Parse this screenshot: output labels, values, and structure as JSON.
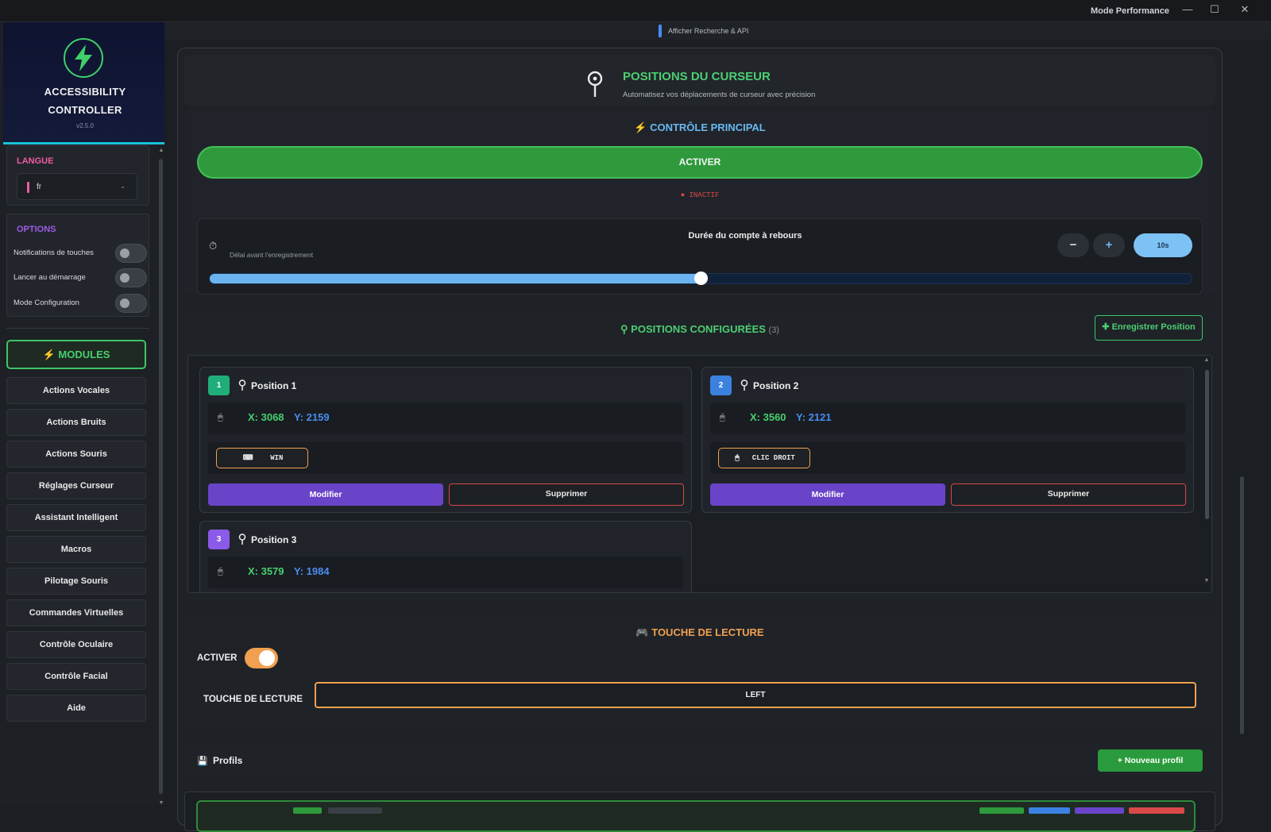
{
  "titlebar": {
    "mode": "Mode Performance",
    "minimize": "—",
    "maximize": "☐",
    "close": "✕"
  },
  "brand": {
    "line1": "ACCESSIBILITY",
    "line2": "CONTROLLER",
    "version": "v2.5.0",
    "icon": "lightning-bolt-icon"
  },
  "langue": {
    "title": "LANGUE",
    "value": "fr",
    "title_color": "#f05aa0"
  },
  "options": {
    "title": "OPTIONS",
    "title_color": "#a05ae8",
    "items": [
      {
        "label": "Notifications de touches",
        "on": false
      },
      {
        "label": "Lancer au démarrage",
        "on": false
      },
      {
        "label": "Mode Configuration",
        "on": false
      }
    ]
  },
  "modules": {
    "label": "MODULES",
    "accent": "#46d06e"
  },
  "nav": [
    "Actions Vocales",
    "Actions Bruits",
    "Actions Souris",
    "Réglages Curseur",
    "Assistant Intelligent",
    "Macros",
    "Pilotage Souris",
    "Commandes Virtuelles",
    "Contrôle Oculaire",
    "Contrôle Facial",
    "Aide"
  ],
  "api_strip": {
    "label": "Afficher Recherche & API"
  },
  "header": {
    "title": "POSITIONS DU CURSEUR",
    "subtitle": "Automatisez vos déplacements de curseur avec précision"
  },
  "control": {
    "title": "CONTRÔLE PRINCIPAL",
    "activate_label": "ACTIVER",
    "status": "INACTIF",
    "countdown": {
      "title": "Durée du compte à rebours",
      "subtitle": "Délai avant l'enregistrement",
      "minus": "−",
      "plus": "+",
      "value_label": "10s",
      "fraction": 0.5
    }
  },
  "positions": {
    "title": "POSITIONS CONFIGURÉES",
    "count": "(3)",
    "register_label": "Enregistrer Position",
    "items": [
      {
        "num": "1",
        "name": "Position 1",
        "x": "X: 3068",
        "y": "Y: 2159",
        "key": "WIN",
        "key_icon": "⌨",
        "color": "#1fae7a"
      },
      {
        "num": "2",
        "name": "Position 2",
        "x": "X: 3560",
        "y": "Y: 2121",
        "key": "CLIC DROIT",
        "key_icon": "🖱",
        "color": "#3b82e0"
      },
      {
        "num": "3",
        "name": "Position 3",
        "x": "X: 3579",
        "y": "Y: 1984",
        "key": "",
        "key_icon": "",
        "color": "#8b5ae8"
      }
    ],
    "edit_label": "Modifier",
    "delete_label": "Supprimer"
  },
  "reading_key": {
    "title": "TOUCHE DE LECTURE",
    "activate_label": "ACTIVER",
    "enabled": true,
    "field_label": "TOUCHE DE LECTURE",
    "field_value": "LEFT"
  },
  "profiles": {
    "title": "Profils",
    "new_label": "+ Nouveau profil"
  }
}
